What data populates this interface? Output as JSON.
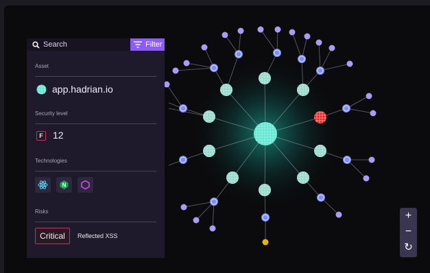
{
  "search": {
    "placeholder": "Search"
  },
  "filter": {
    "label": "Filter"
  },
  "asset": {
    "section_label": "Asset",
    "name": "app.hadrian.io"
  },
  "security": {
    "section_label": "Security level",
    "grade": "F",
    "score": "12"
  },
  "technologies": {
    "section_label": "Technologies",
    "items": [
      {
        "icon": "react-icon",
        "color": "#61dafb"
      },
      {
        "icon": "nginx-icon",
        "color": "#22c55e"
      },
      {
        "icon": "hexagon-icon",
        "color": "#d946ef"
      }
    ]
  },
  "risks": {
    "section_label": "Risks",
    "severity": "Critical",
    "name": "Reflected XSS"
  },
  "zoom": {
    "in_label": "+",
    "out_label": "−",
    "reset_label": "↻"
  },
  "graph": {
    "center_color": "#5ee6d0",
    "risk_node_color": "#ef1f1f",
    "leaf_color": "#a99cf5",
    "hub_color": "#7e8ef2",
    "highlight_color": "#eab308"
  }
}
